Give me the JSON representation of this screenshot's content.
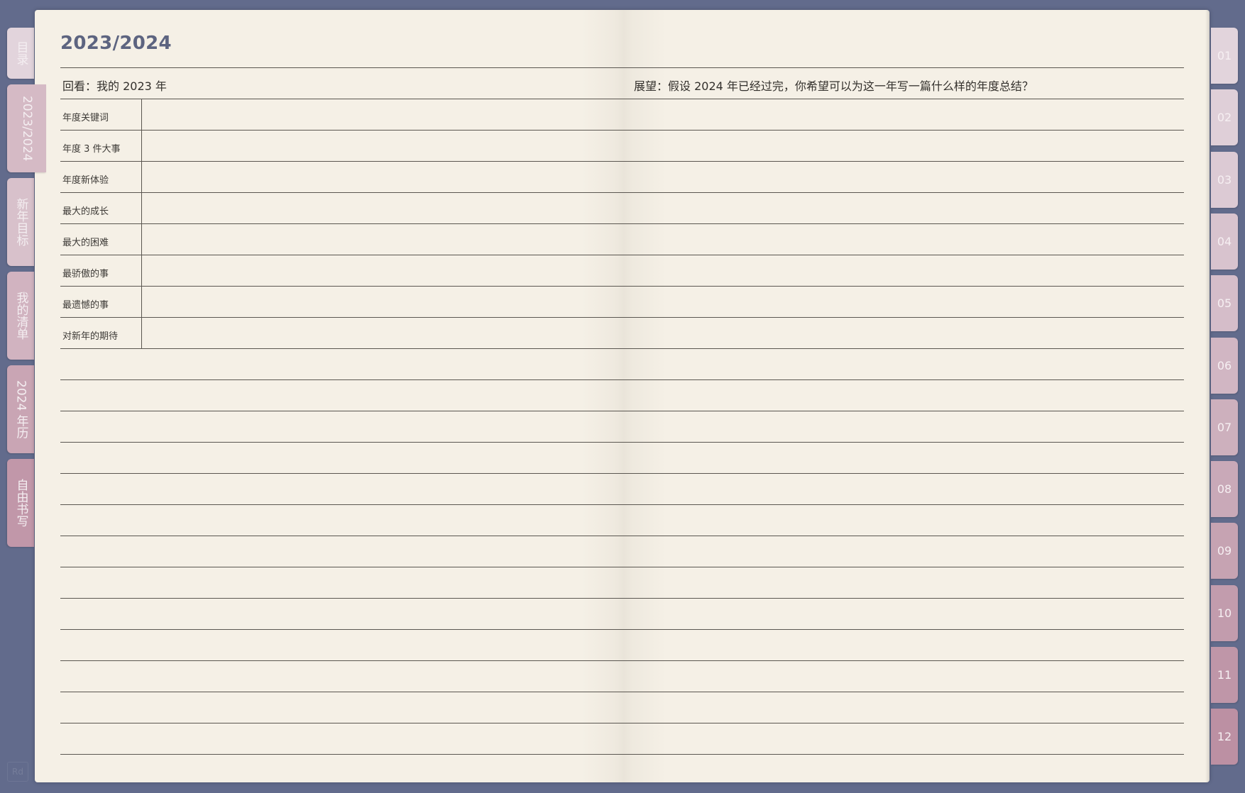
{
  "page": {
    "title": "2023/2024",
    "review_prompt": "回看：我的 2023 年",
    "outlook_prompt": "展望：假设 2024 年已经过完，你希望可以为这一年写一篇什么样的年度总结？",
    "review_items": [
      "年度关键词",
      "年度 3 件大事",
      "年度新体验",
      "最大的成长",
      "最大的困难",
      "最骄傲的事",
      "最遗憾的事",
      "对新年的期待"
    ]
  },
  "left_tabs": [
    {
      "label": "目录",
      "color": "#e2d4dc"
    },
    {
      "label": "2023/2024",
      "color": "#d5bac5",
      "active": true
    },
    {
      "label": "新年目标",
      "color": "#d8c1cb"
    },
    {
      "label": "我的清单",
      "color": "#d1b3c0"
    },
    {
      "label": "2024 年历",
      "color": "#c9a5b4"
    },
    {
      "label": "自由书写",
      "color": "#c197a9"
    }
  ],
  "month_tabs": [
    {
      "label": "01",
      "color": "#e2d4dc"
    },
    {
      "label": "02",
      "color": "#dfcfd8"
    },
    {
      "label": "03",
      "color": "#dccad4"
    },
    {
      "label": "04",
      "color": "#d8c3ce"
    },
    {
      "label": "05",
      "color": "#d5bdc9"
    },
    {
      "label": "06",
      "color": "#d1b6c3"
    },
    {
      "label": "07",
      "color": "#cdb0bd"
    },
    {
      "label": "08",
      "color": "#c9a9b8"
    },
    {
      "label": "09",
      "color": "#c6a3b2"
    },
    {
      "label": "10",
      "color": "#c29cad"
    },
    {
      "label": "11",
      "color": "#bf96a8"
    },
    {
      "label": "12",
      "color": "#bc90a3"
    }
  ],
  "logo": {
    "text": "Rd"
  }
}
